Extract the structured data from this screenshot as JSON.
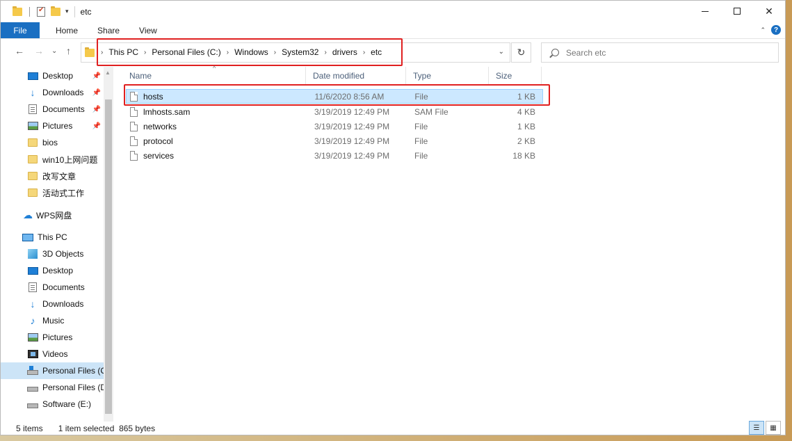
{
  "window": {
    "title": "etc",
    "minimize_glyph": "",
    "maximize_glyph": "",
    "close_glyph": "✕"
  },
  "ribbon": {
    "file_tab": "File",
    "tabs": [
      "Home",
      "Share",
      "View"
    ],
    "collapse_glyph": "⌃",
    "help_glyph": "?"
  },
  "navigation": {
    "back_glyph": "←",
    "forward_glyph": "→",
    "recent_glyph": "⌄",
    "up_glyph": "↑",
    "breadcrumbs": [
      "This PC",
      "Personal Files (C:)",
      "Windows",
      "System32",
      "drivers",
      "etc"
    ],
    "crumb_separator": "›",
    "address_dropdown_glyph": "⌄",
    "refresh_glyph": "↻",
    "search_placeholder": "Search etc"
  },
  "sidebar": {
    "items": [
      {
        "label": "Desktop",
        "icon": "desktop-icon",
        "pinned": true
      },
      {
        "label": "Downloads",
        "icon": "download-icon",
        "pinned": true
      },
      {
        "label": "Documents",
        "icon": "document-icon",
        "pinned": true
      },
      {
        "label": "Pictures",
        "icon": "pictures-icon",
        "pinned": true
      },
      {
        "label": "bios",
        "icon": "folder-icon",
        "pinned": false
      },
      {
        "label": "win10上网问题",
        "icon": "folder-icon",
        "pinned": false
      },
      {
        "label": "改写文章",
        "icon": "folder-icon",
        "pinned": false
      },
      {
        "label": "活动式工作",
        "icon": "folder-icon",
        "pinned": false
      },
      {
        "label": "WPS网盘",
        "icon": "cloud-icon",
        "pinned": false
      },
      {
        "label": "This PC",
        "icon": "computer-icon",
        "pinned": false
      },
      {
        "label": "3D Objects",
        "icon": "3d-objects-icon",
        "pinned": false
      },
      {
        "label": "Desktop",
        "icon": "desktop-icon",
        "pinned": false
      },
      {
        "label": "Documents",
        "icon": "document-icon",
        "pinned": false
      },
      {
        "label": "Downloads",
        "icon": "download-icon",
        "pinned": false
      },
      {
        "label": "Music",
        "icon": "music-icon",
        "pinned": false
      },
      {
        "label": "Pictures",
        "icon": "pictures-icon",
        "pinned": false
      },
      {
        "label": "Videos",
        "icon": "videos-icon",
        "pinned": false
      },
      {
        "label": "Personal Files (C",
        "icon": "drive-icon",
        "pinned": false,
        "selected": true
      },
      {
        "label": "Personal Files (D",
        "icon": "drive-icon",
        "pinned": false
      },
      {
        "label": "Software (E:)",
        "icon": "drive-icon",
        "pinned": false
      }
    ],
    "pin_glyph": "📌"
  },
  "filelist": {
    "columns": [
      "Name",
      "Date modified",
      "Type",
      "Size"
    ],
    "sort_glyph": "^",
    "files": [
      {
        "name": "hosts",
        "date": "11/6/2020 8:56 AM",
        "type": "File",
        "size": "1 KB",
        "selected": true
      },
      {
        "name": "lmhosts.sam",
        "date": "3/19/2019 12:49 PM",
        "type": "SAM File",
        "size": "4 KB"
      },
      {
        "name": "networks",
        "date": "3/19/2019 12:49 PM",
        "type": "File",
        "size": "1 KB"
      },
      {
        "name": "protocol",
        "date": "3/19/2019 12:49 PM",
        "type": "File",
        "size": "2 KB"
      },
      {
        "name": "services",
        "date": "3/19/2019 12:49 PM",
        "type": "File",
        "size": "18 KB"
      }
    ]
  },
  "statusbar": {
    "item_count": "5 items",
    "selection": "1 item selected  865 bytes"
  },
  "colors": {
    "accent": "#1a6fc2",
    "selection": "#cce8ff",
    "annotation": "#e02020"
  }
}
